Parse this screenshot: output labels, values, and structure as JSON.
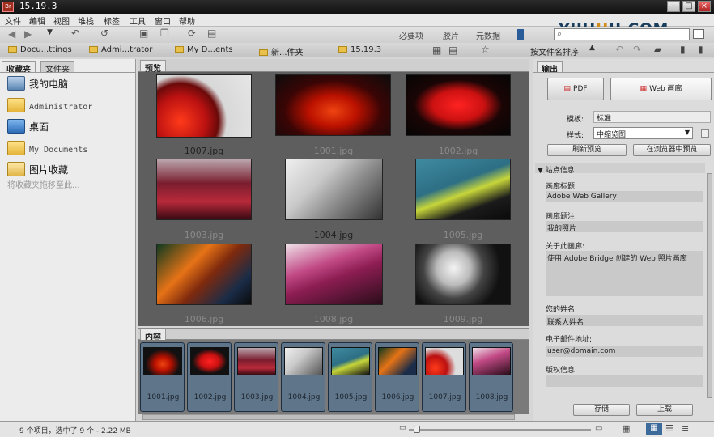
{
  "window": {
    "title": "15.19.3"
  },
  "logo": {
    "text_main": "YIIH",
    "text_u": "U",
    "text_rest": "U.COM"
  },
  "menu": [
    "文件",
    "编辑",
    "视图",
    "堆栈",
    "标签",
    "工具",
    "窗口",
    "帮助"
  ],
  "workspaces": [
    "必要项",
    "胶片",
    "元数据"
  ],
  "breadcrumb": [
    "Docu...ttings",
    "Admi...trator",
    "My D...ents",
    "新...件夹",
    "15.19.3"
  ],
  "sort_label": "按文件名排序",
  "left_tabs": [
    "收藏夹",
    "文件夹"
  ],
  "favorites": [
    {
      "label": "我的电脑",
      "icon": "computer-icon"
    },
    {
      "label": "Administrator",
      "icon": "folder-icon"
    },
    {
      "label": "桌面",
      "icon": "desktop-icon"
    },
    {
      "label": "My Documents",
      "icon": "folder-icon"
    },
    {
      "label": "图片收藏",
      "icon": "pictures-folder-icon"
    }
  ],
  "favorites_hint": "将收藏夹拖移至此...",
  "preview_tab": "预览",
  "grid_captions": [
    "1007.jpg",
    "1001.jpg",
    "1002.jpg",
    "1003.jpg",
    "1004.jpg",
    "1005.jpg",
    "1006.jpg",
    "1008.jpg",
    "1009.jpg"
  ],
  "content_tab": "内容",
  "filmstrip": [
    "1001.jpg",
    "1002.jpg",
    "1003.jpg",
    "1004.jpg",
    "1005.jpg",
    "1006.jpg",
    "1007.jpg",
    "1008.jpg"
  ],
  "output": {
    "tab": "输出",
    "pdf_label": "PDF",
    "web_label": "Web 画廊",
    "template_label": "模板:",
    "template_value": "标准",
    "style_label": "样式:",
    "style_value": "中缩览图",
    "refresh_button": "刷新预览",
    "browser_preview_button": "在浏览器中预览",
    "section_title": "站点信息",
    "gallery_title_label": "画廊标题:",
    "gallery_title_value": "Adobe Web Gallery",
    "gallery_caption_label": "画廊题注:",
    "gallery_caption_value": "我的照片",
    "about_label": "关于此画廊:",
    "about_value": "使用 Adobe Bridge 创建的 Web 照片画廊",
    "name_label": "您的姓名:",
    "name_value": "联系人姓名",
    "email_label": "电子邮件地址:",
    "email_value": "user@domain.com",
    "copyright_label": "版权信息:",
    "save_button": "存储",
    "upload_button": "上载"
  },
  "status": {
    "text": "9 个项目，选中了 9 个 - 2.22 MB"
  },
  "colors": {
    "accent": "#4a7fb0",
    "filmstrip_item": "#5f7589",
    "titlebar": "#1a1a1a"
  }
}
